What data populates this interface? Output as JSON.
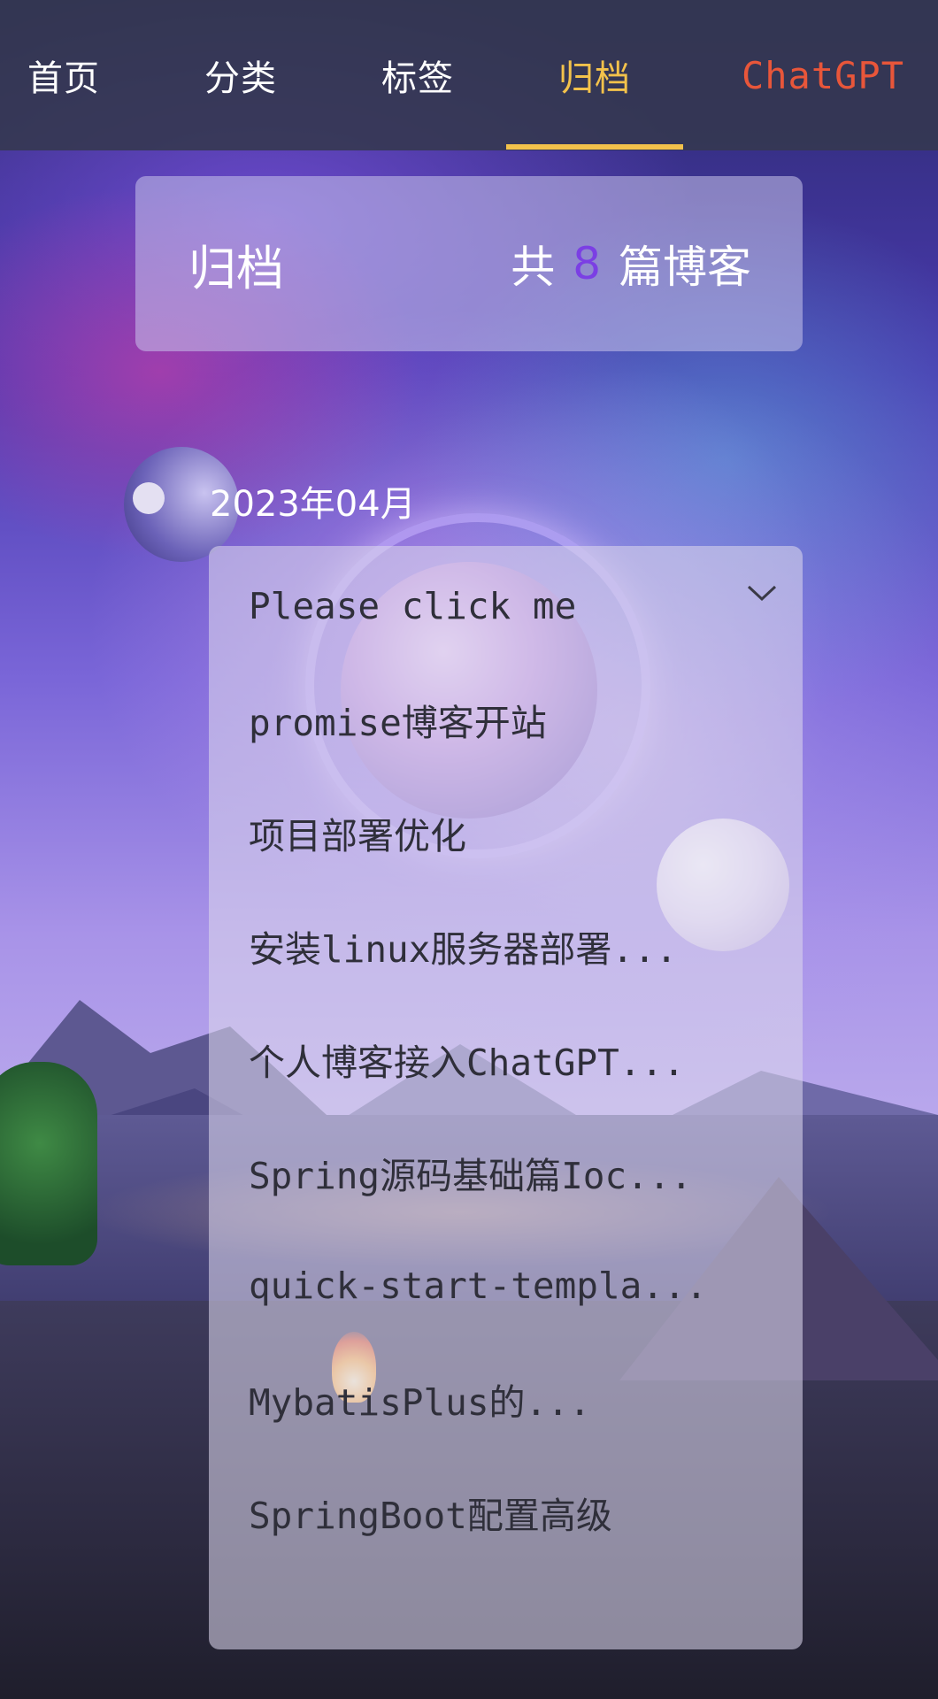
{
  "nav": {
    "items": [
      {
        "label": "首页"
      },
      {
        "label": "分类"
      },
      {
        "label": "标签"
      },
      {
        "label": "归档"
      },
      {
        "label": "ChatGPT"
      }
    ],
    "active_index": 3,
    "active_color": "#f3c24b",
    "chatgpt_color": "#e8563a"
  },
  "header": {
    "title": "归档",
    "count_prefix": "共",
    "count": "8",
    "count_suffix": "篇博客",
    "count_color": "#7b3fe4"
  },
  "timeline": {
    "date": "2023年04月"
  },
  "posts": {
    "dropdown_label": "Please click me",
    "dropdown_icon": "chevron-down-icon",
    "items": [
      "promise博客开站",
      "项目部署优化",
      "安装linux服务器部署...",
      "个人博客接入ChatGPT...",
      "Spring源码基础篇Ioc...",
      "quick-start-templa...",
      "MybatisPlus的...",
      "SpringBoot配置高级"
    ]
  }
}
